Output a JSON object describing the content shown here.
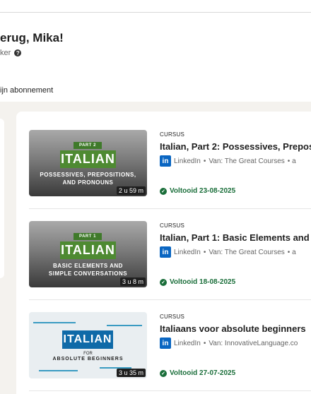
{
  "header": {
    "greeting": "erug, Mika!",
    "subtitle": "ker",
    "subscription_link": "ijn abonnement"
  },
  "courses": [
    {
      "type": "CURSUS",
      "title": "Italian, Part 2: Possessives, Prepos",
      "provider": "LinkedIn",
      "author": "Van: The Great Courses",
      "extra": "• a",
      "status": "Voltooid 23-08-2025",
      "duration": "2 u 59 m",
      "thumb_part": "PART 2",
      "thumb_title": "ITALIAN",
      "thumb_sub1": "POSSESSIVES, PREPOSITIONS,",
      "thumb_sub2": "AND PRONOUNS"
    },
    {
      "type": "CURSUS",
      "title": "Italian, Part 1: Basic Elements and",
      "provider": "LinkedIn",
      "author": "Van: The Great Courses",
      "extra": "• a",
      "status": "Voltooid 18-08-2025",
      "duration": "3 u 8 m",
      "thumb_part": "PART 1",
      "thumb_title": "ITALIAN",
      "thumb_sub1": "BASIC ELEMENTS AND",
      "thumb_sub2": "SIMPLE CONVERSATIONS"
    },
    {
      "type": "CURSUS",
      "title": "Italiaans voor absolute beginners",
      "provider": "LinkedIn",
      "author": "Van: InnovativeLanguage.co",
      "extra": "",
      "status": "Voltooid 27-07-2025",
      "duration": "3 u 35 m",
      "thumb_title": "ITALIAN",
      "thumb_for": "FOR",
      "thumb_sub": "ABSOLUTE BEGINNERS"
    }
  ],
  "icons": {
    "linkedin": "in",
    "check": "✓",
    "help": "?"
  }
}
